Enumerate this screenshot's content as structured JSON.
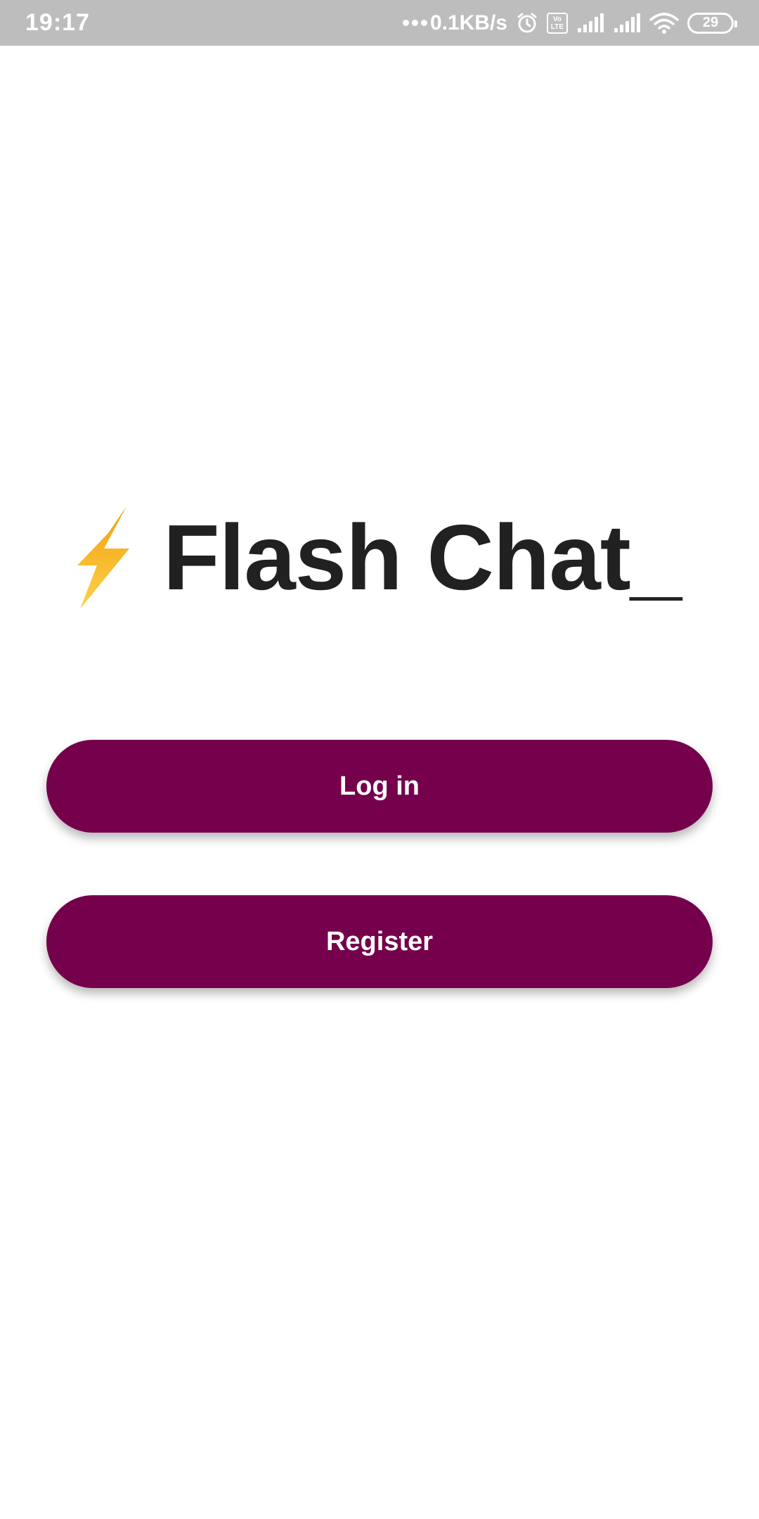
{
  "status_bar": {
    "time": "19:17",
    "net_speed": "0.1KB/s",
    "volte_top": "Vo",
    "volte_bottom": "LTE",
    "battery": "29",
    "icons": [
      "alarm-icon",
      "volte-icon",
      "signal-icon",
      "signal-icon",
      "wifi-icon",
      "battery-icon"
    ]
  },
  "app": {
    "title": "Flash Chat_",
    "logo_icon": "lightning-bolt-icon",
    "accent_color": "#75004c",
    "bolt_color": "#fbbf24"
  },
  "buttons": {
    "login_label": "Log in",
    "register_label": "Register"
  }
}
